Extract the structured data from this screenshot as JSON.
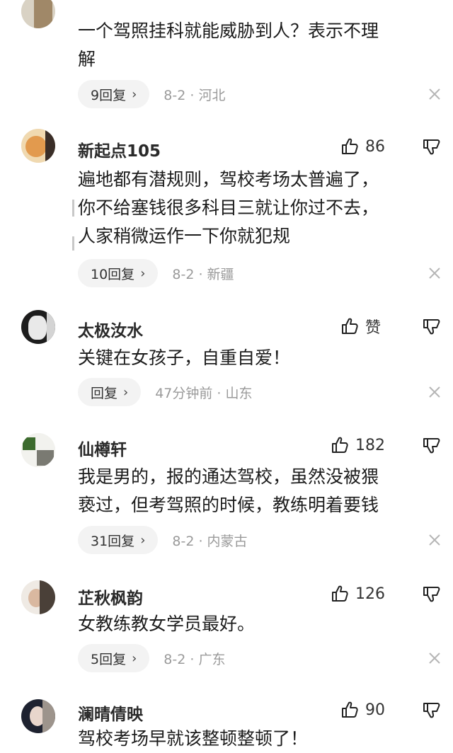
{
  "comments": [
    {
      "name": "",
      "like_count": "",
      "lines": [
        "一个驾照挂科就能威胁到人？表示不理",
        "解"
      ],
      "reply_label": "9回复",
      "meta": "8-2 · 河北"
    },
    {
      "name": "新起点105",
      "like_count": "86",
      "lines": [
        "遍地都有潜规则，驾校考场太普遍了，",
        "你不给塞钱很多科目三就让你过不去，",
        "人家稍微运作一下你就犯规"
      ],
      "reply_label": "10回复",
      "meta": "8-2 · 新疆"
    },
    {
      "name": "太极汝水",
      "like_count": "赞",
      "lines": [
        "关键在女孩子，自重自爱！"
      ],
      "reply_label": "回复",
      "meta": "47分钟前 · 山东"
    },
    {
      "name": "仙樽轩",
      "like_count": "182",
      "lines": [
        "我是男的，报的通达驾校，虽然没被猥",
        "亵过，但考驾照的时候，教练明着要钱"
      ],
      "reply_label": "31回复",
      "meta": "8-2 · 内蒙古"
    },
    {
      "name": "芷秋枫韵",
      "like_count": "126",
      "lines": [
        "女教练教女学员最好。"
      ],
      "reply_label": "5回复",
      "meta": "8-2 · 广东"
    },
    {
      "name": "澜晴倩映",
      "like_count": "90",
      "lines": [
        "驾校考场早就该整顿整顿了！"
      ],
      "reply_label": "",
      "meta": ""
    }
  ],
  "icons": {
    "like": "thumbs-up-icon",
    "dislike": "thumbs-down-icon",
    "close": "close-icon",
    "chevron": "chevron-right-icon"
  },
  "colors": {
    "meta_text": "#9a9a9a",
    "pill_bg": "#f3f3f3",
    "body_text": "#1c1c1c"
  }
}
